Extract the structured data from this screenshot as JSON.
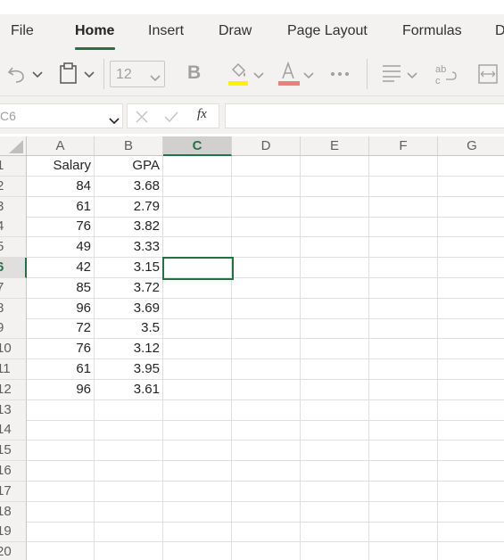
{
  "ribbon": {
    "tabs": [
      {
        "label": "File"
      },
      {
        "label": "Home",
        "active": true
      },
      {
        "label": "Insert"
      },
      {
        "label": "Draw"
      },
      {
        "label": "Page Layout"
      },
      {
        "label": "Formulas"
      },
      {
        "label": "D"
      }
    ]
  },
  "toolbar": {
    "font_size": "12",
    "bold_label": "B"
  },
  "formula_bar": {
    "name_box": "C6",
    "fx_label": "fx",
    "formula": ""
  },
  "sheet": {
    "columns": [
      "A",
      "B",
      "C",
      "D",
      "E",
      "F",
      "G"
    ],
    "selected_column": "C",
    "selected_row": "6",
    "rows": [
      "1",
      "2",
      "3",
      "4",
      "5",
      "6",
      "7",
      "8",
      "9",
      "10",
      "11",
      "12",
      "13",
      "14",
      "15",
      "16",
      "17",
      "18",
      "19",
      "20"
    ],
    "headers": {
      "A": "Salary",
      "B": "GPA"
    },
    "data": [
      {
        "salary": "84",
        "gpa": "3.68"
      },
      {
        "salary": "61",
        "gpa": "2.79"
      },
      {
        "salary": "76",
        "gpa": "3.82"
      },
      {
        "salary": "49",
        "gpa": "3.33"
      },
      {
        "salary": "42",
        "gpa": "3.15"
      },
      {
        "salary": "85",
        "gpa": "3.72"
      },
      {
        "salary": "96",
        "gpa": "3.69"
      },
      {
        "salary": "72",
        "gpa": "3.5"
      },
      {
        "salary": "76",
        "gpa": "3.12"
      },
      {
        "salary": "61",
        "gpa": "3.95"
      },
      {
        "salary": "96",
        "gpa": "3.61"
      }
    ]
  }
}
